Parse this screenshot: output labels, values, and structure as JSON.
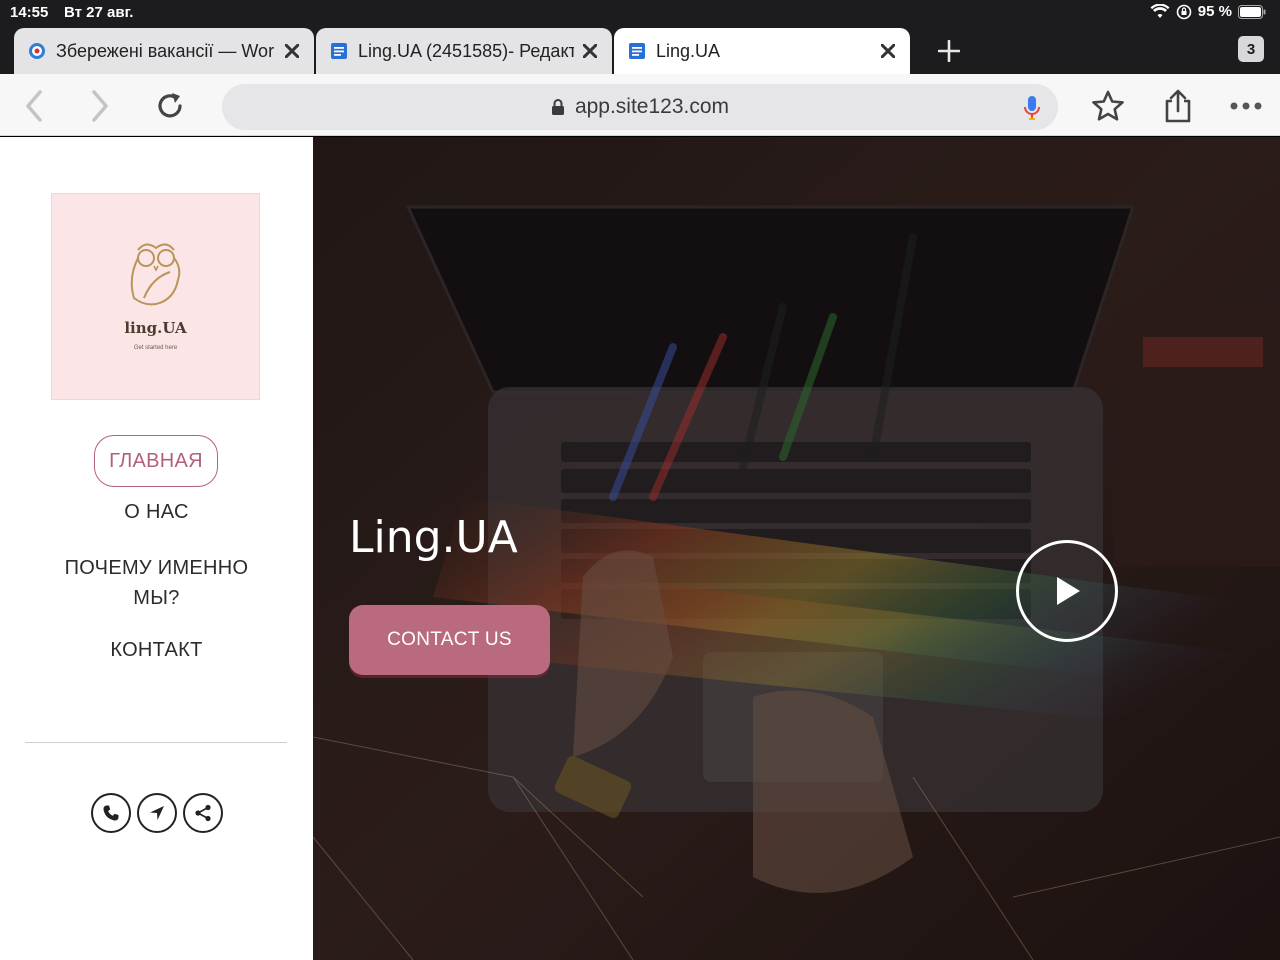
{
  "status_bar": {
    "time": "14:55",
    "date": "Вт 27 авг.",
    "battery": "95 %"
  },
  "tabs": [
    {
      "title": "Збережені вакансії — Wor",
      "active": false
    },
    {
      "title": "Ling.UA (2451585)- Редакт",
      "active": false
    },
    {
      "title": "Ling.UA",
      "active": true
    }
  ],
  "tab_count": "3",
  "address_bar": {
    "url": "app.site123.com"
  },
  "logo": {
    "brand": "ling.UA",
    "tagline": "Get started here"
  },
  "nav": {
    "home": "ГЛАВНАЯ",
    "about": "О НАС",
    "why": "ПОЧЕМУ ИМЕННО МЫ?",
    "contact": "КОНТАКТ"
  },
  "hero": {
    "title": "Ling.UA",
    "button": "CONTACT US"
  },
  "colors": {
    "accent": "#b96a7f",
    "logo_bg": "#fce5e7",
    "browser_chrome": "#1c1c1e"
  },
  "icons": [
    "phone-icon",
    "navigation-icon",
    "share-icon",
    "play-icon",
    "microphone-icon",
    "lock-icon",
    "star-icon",
    "share-browser-icon",
    "more-icon",
    "reload-icon"
  ]
}
